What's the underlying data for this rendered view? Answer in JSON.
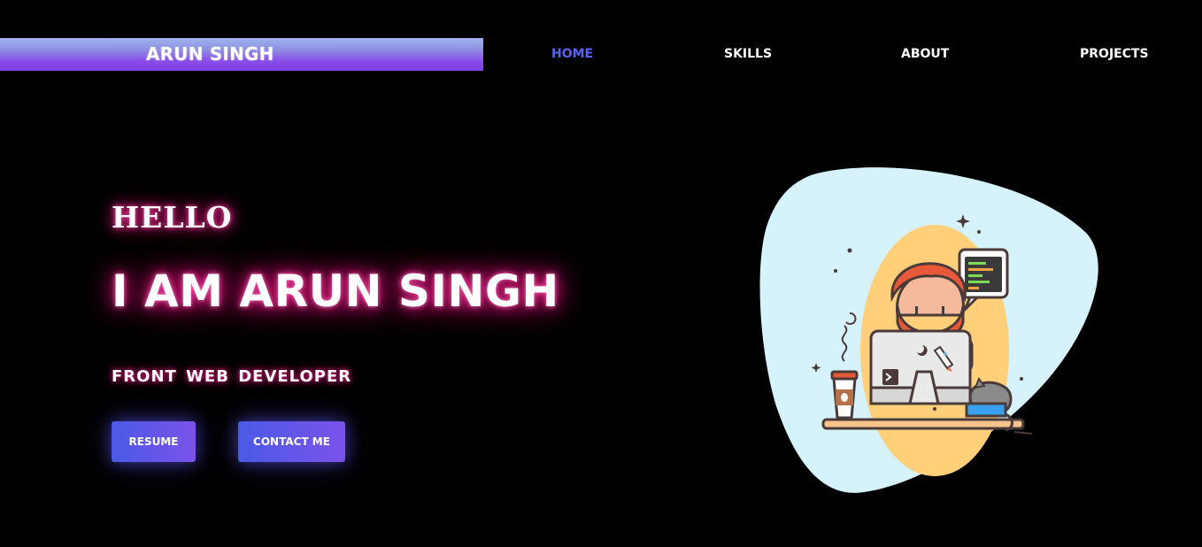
{
  "header": {
    "logo": "ARUN SINGH",
    "nav": [
      {
        "label": "HOME",
        "active": true
      },
      {
        "label": "SKILLS",
        "active": false
      },
      {
        "label": "ABOUT",
        "active": false
      },
      {
        "label": "PROJECTS",
        "active": false
      }
    ]
  },
  "hero": {
    "greeting": "HELLO",
    "headline": "I AM ARUN SINGH",
    "subtitle": "FRONT WEB DEVELOPER",
    "buttons": {
      "resume": "RESUME",
      "contact": "CONTACT ME"
    }
  },
  "colors": {
    "background": "#000000",
    "accent_blue": "#5a63ee",
    "button_gradient_start": "#4a5ae6",
    "button_gradient_end": "#7b52ea",
    "neon_pink": "#e0147a",
    "blob": "#d6f2fa",
    "sun": "#ffcf7a"
  },
  "illustration": {
    "icon": "developer-at-computer-illustration"
  }
}
